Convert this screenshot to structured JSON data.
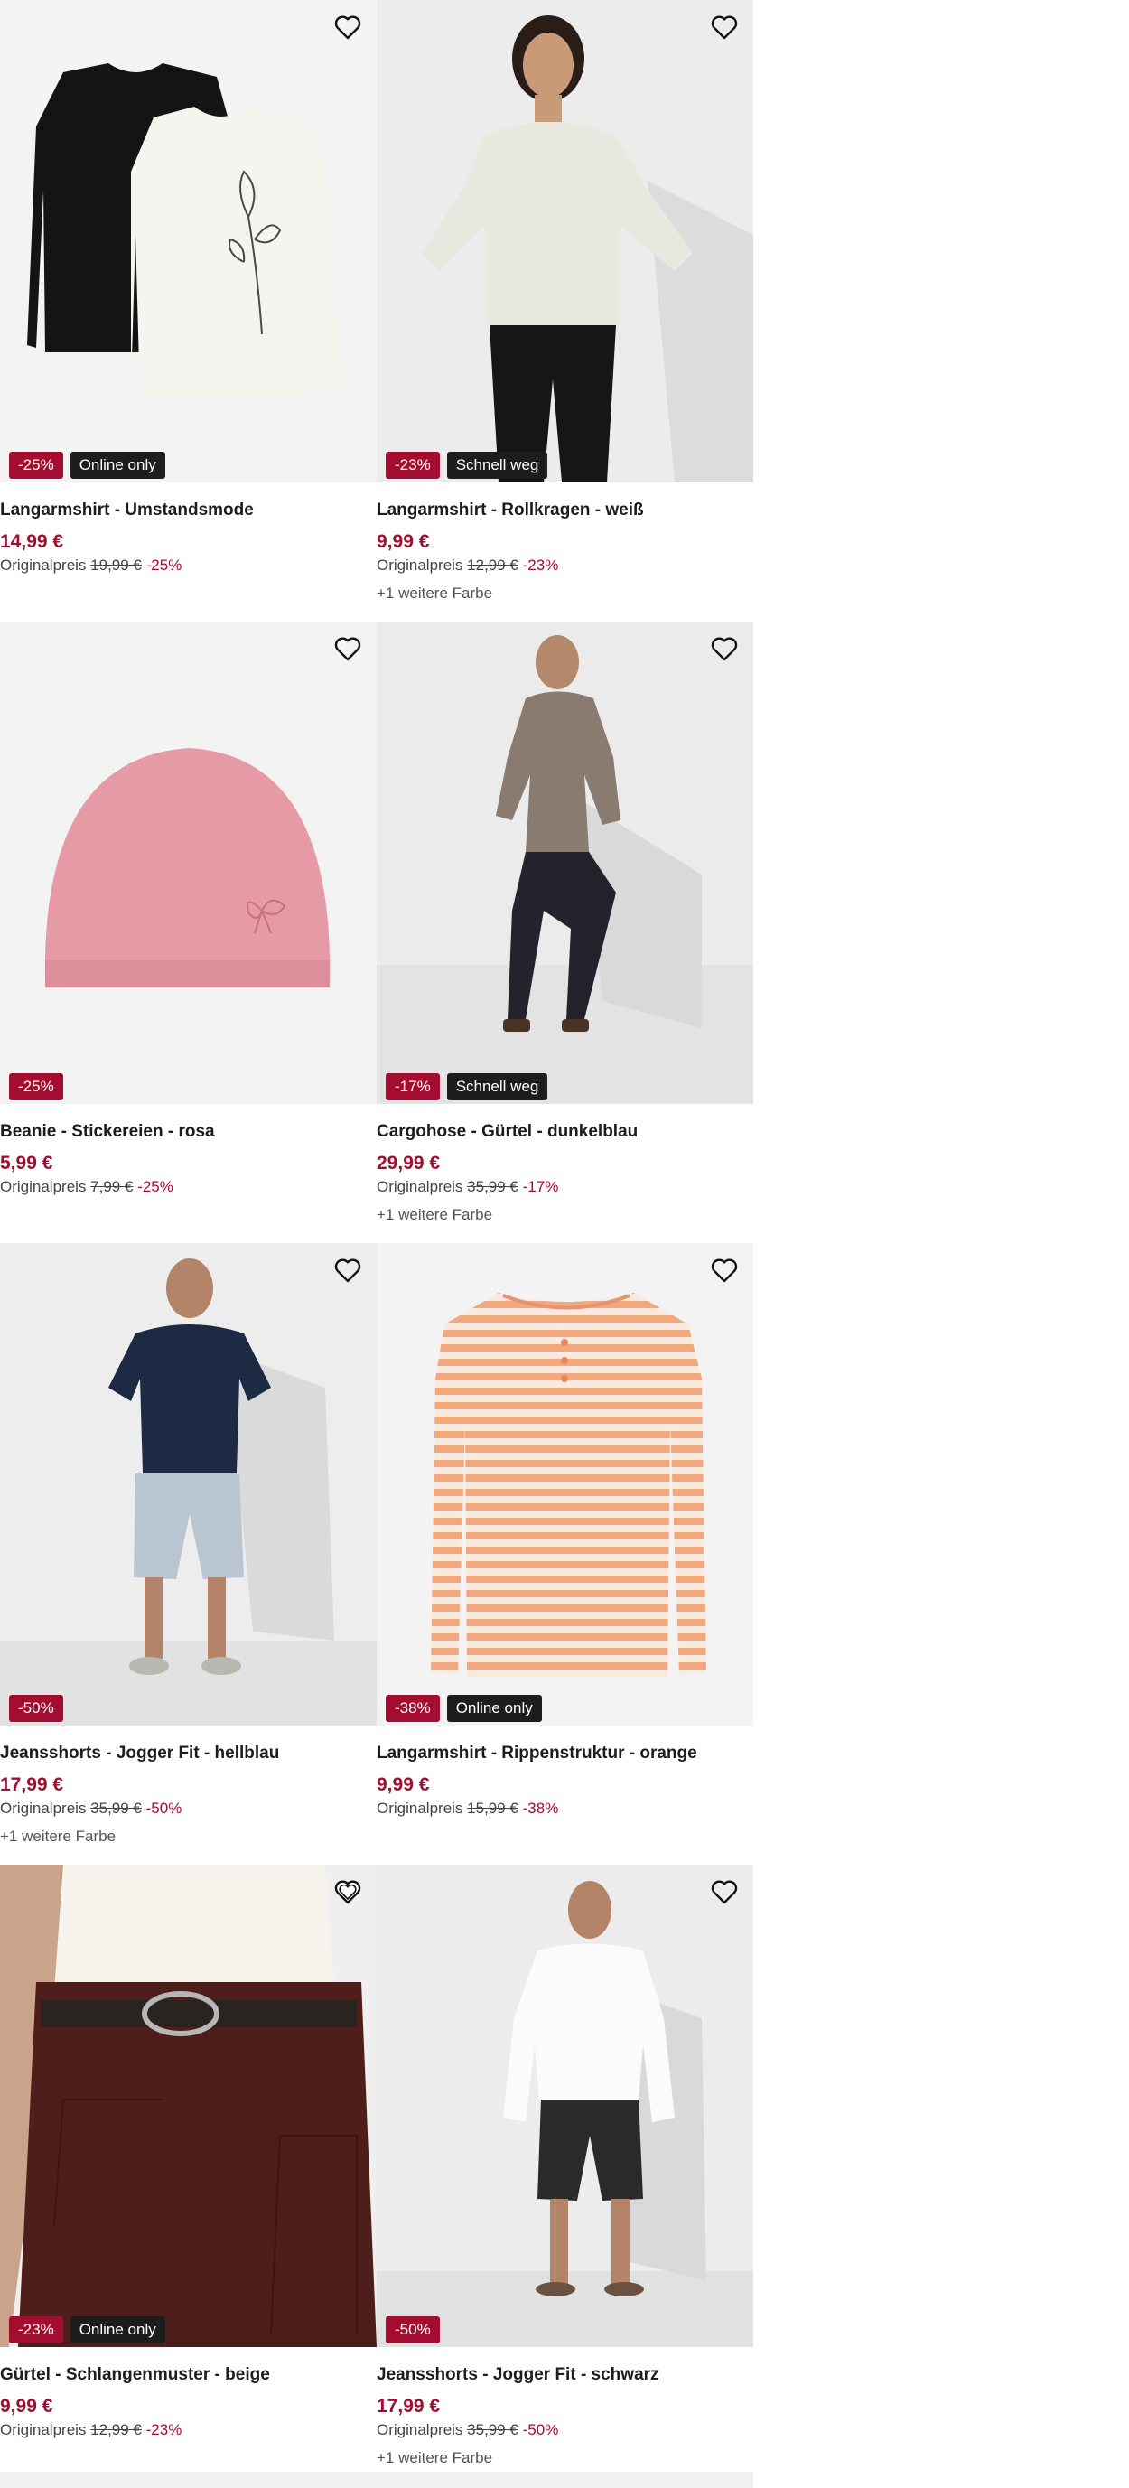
{
  "products": [
    {
      "title": "Langarmshirt - Umstandsmode",
      "price": "14,99 €",
      "orig_label": "Originalpreis",
      "orig_price": "19,99 €",
      "orig_pct": "-25%",
      "discount": "-25%",
      "tag": "Online only",
      "more": "",
      "favorited": false,
      "image": "two-longsleeve-shirts-black-white"
    },
    {
      "title": "Langarmshirt - Rollkragen - weiß",
      "price": "9,99 €",
      "orig_label": "Originalpreis",
      "orig_price": "12,99 €",
      "orig_pct": "-23%",
      "discount": "-23%",
      "tag": "Schnell weg",
      "more": "+1 weitere Farbe",
      "favorited": false,
      "image": "model-white-turtleneck"
    },
    {
      "title": "Beanie - Stickereien - rosa",
      "price": "5,99 €",
      "orig_label": "Originalpreis",
      "orig_price": "7,99 €",
      "orig_pct": "-25%",
      "discount": "-25%",
      "tag": "",
      "more": "",
      "favorited": false,
      "image": "pink-beanie"
    },
    {
      "title": "Cargohose - Gürtel - dunkelblau",
      "price": "29,99 €",
      "orig_label": "Originalpreis",
      "orig_price": "35,99 €",
      "orig_pct": "-17%",
      "discount": "-17%",
      "tag": "Schnell weg",
      "more": "+1 weitere Farbe",
      "favorited": false,
      "image": "model-cargo-pants"
    },
    {
      "title": "Jeansshorts - Jogger Fit - hellblau",
      "price": "17,99 €",
      "orig_label": "Originalpreis",
      "orig_price": "35,99 €",
      "orig_pct": "-50%",
      "discount": "-50%",
      "tag": "",
      "more": "+1 weitere Farbe",
      "favorited": false,
      "image": "model-light-jeans-shorts"
    },
    {
      "title": "Langarmshirt - Rippenstruktur - orange",
      "price": "9,99 €",
      "orig_label": "Originalpreis",
      "orig_price": "15,99 €",
      "orig_pct": "-38%",
      "discount": "-38%",
      "tag": "Online only",
      "more": "",
      "favorited": false,
      "image": "striped-orange-longsleeve"
    },
    {
      "title": "Gürtel - Schlangenmuster - beige",
      "price": "9,99 €",
      "orig_label": "Originalpreis",
      "orig_price": "12,99 €",
      "orig_pct": "-23%",
      "discount": "-23%",
      "tag": "Online only",
      "more": "",
      "favorited": true,
      "image": "snake-belt-brown-pants"
    },
    {
      "title": "Jeansshorts - Jogger Fit - schwarz",
      "price": "17,99 €",
      "orig_label": "Originalpreis",
      "orig_price": "35,99 €",
      "orig_pct": "-50%",
      "discount": "-50%",
      "tag": "",
      "more": "+1 weitere Farbe",
      "favorited": false,
      "image": "model-black-jeans-shorts"
    }
  ],
  "colors": {
    "accent": "#a30d2f",
    "tag_bg": "#1d1d1b",
    "image_bg": "#f1f1f1"
  }
}
